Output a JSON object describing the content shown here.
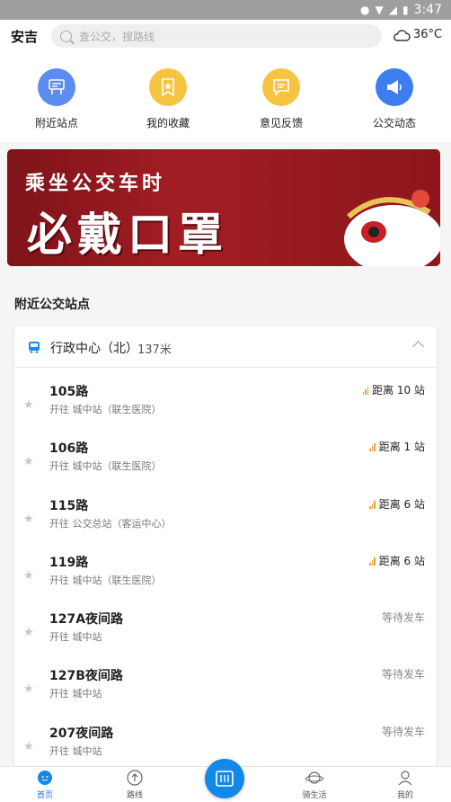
{
  "status_bar": {
    "time": "3:47"
  },
  "header": {
    "city": "安吉",
    "search_placeholder": "查公交，搜路线",
    "temperature": "36°C",
    "weather_icon": "cloud-icon"
  },
  "quick_actions": [
    {
      "label": "附近站点",
      "icon": "bus-stop-icon",
      "color": "#5b8def"
    },
    {
      "label": "我的收藏",
      "icon": "bookmark-star-icon",
      "color": "#f5c542"
    },
    {
      "label": "意见反馈",
      "icon": "feedback-icon",
      "color": "#f5c542"
    },
    {
      "label": "公交动态",
      "icon": "megaphone-icon",
      "color": "#3d7df0"
    }
  ],
  "banner": {
    "line1": "乘坐公交车时",
    "line2": "必戴口罩"
  },
  "nearby": {
    "title": "附近公交站点",
    "stop_name": "行政中心（北）",
    "stop_distance": "137米",
    "routes": [
      {
        "name": "105路",
        "dest": "开往 城中站（联生医院）",
        "status": "距离 10 站",
        "signal": true
      },
      {
        "name": "106路",
        "dest": "开往 城中站（联生医院）",
        "status": "距离 1 站",
        "signal": true
      },
      {
        "name": "115路",
        "dest": "开往 公交总站（客运中心）",
        "status": "距离 6 站",
        "signal": true
      },
      {
        "name": "119路",
        "dest": "开往 城中站（联生医院）",
        "status": "距离 6 站",
        "signal": true
      },
      {
        "name": "127A夜间路",
        "dest": "开往 城中站",
        "status": "等待发车",
        "signal": false
      },
      {
        "name": "127B夜间路",
        "dest": "开往 城中站",
        "status": "等待发车",
        "signal": false
      },
      {
        "name": "207夜间路",
        "dest": "开往 城中站",
        "status": "等待发车",
        "signal": false
      }
    ]
  },
  "tabbar": {
    "items": [
      {
        "label": "首页",
        "icon": "home-icon",
        "active": true
      },
      {
        "label": "路线",
        "icon": "route-icon",
        "active": false
      },
      {
        "label": "",
        "icon": "bus-card-icon",
        "active": false
      },
      {
        "label": "骑生活",
        "icon": "planet-icon",
        "active": false
      },
      {
        "label": "我的",
        "icon": "user-icon",
        "active": false
      }
    ],
    "accent": "#1288e8"
  }
}
